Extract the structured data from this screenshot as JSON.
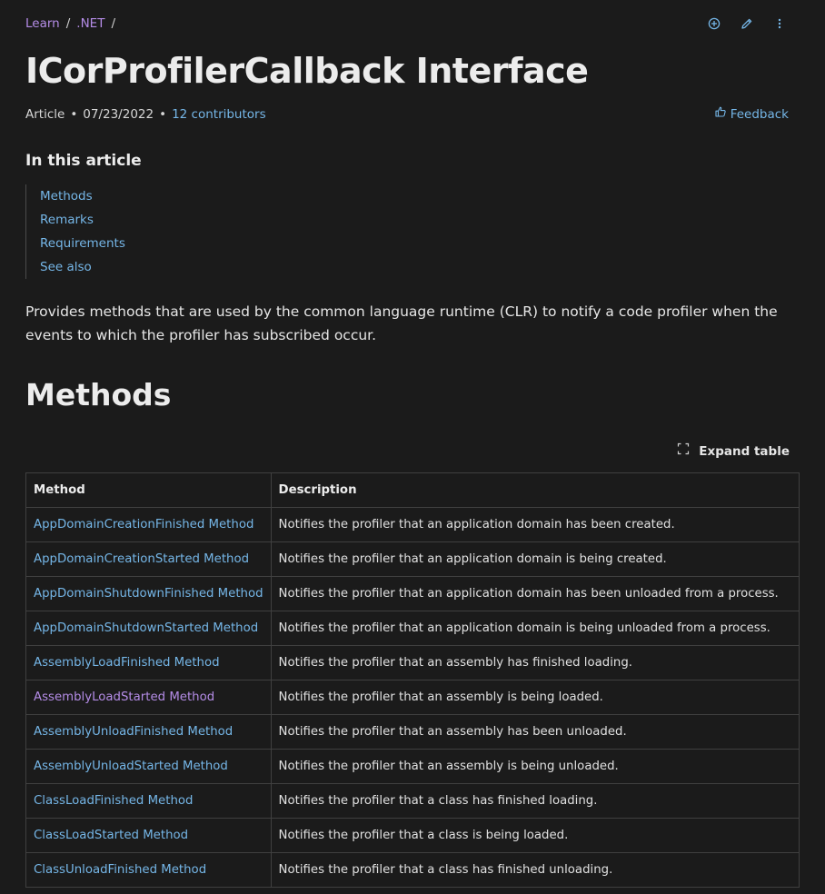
{
  "breadcrumb": {
    "items": [
      "Learn",
      ".NET"
    ],
    "separator": "/"
  },
  "top_actions": {
    "icons": [
      "add-circle-icon",
      "edit-pencil-icon",
      "more-vertical-icon"
    ]
  },
  "header": {
    "title": "ICorProfilerCallback Interface",
    "meta_type": "Article",
    "meta_date": "07/23/2022",
    "meta_contributors": "12 contributors",
    "feedback_label": "Feedback"
  },
  "toc": {
    "title": "In this article",
    "items": [
      "Methods",
      "Remarks",
      "Requirements",
      "See also"
    ]
  },
  "intro": "Provides methods that are used by the common language runtime (CLR) to notify a code profiler when the events to which the profiler has subscribed occur.",
  "methods_section": {
    "heading": "Methods",
    "expand_label": "Expand table",
    "columns": [
      "Method",
      "Description"
    ],
    "rows": [
      {
        "method": "AppDomainCreationFinished Method",
        "description": "Notifies the profiler that an application domain has been created."
      },
      {
        "method": "AppDomainCreationStarted Method",
        "description": "Notifies the profiler that an application domain is being created."
      },
      {
        "method": "AppDomainShutdownFinished Method",
        "description": "Notifies the profiler that an application domain has been unloaded from a process."
      },
      {
        "method": "AppDomainShutdownStarted Method",
        "description": "Notifies the profiler that an application domain is being unloaded from a process."
      },
      {
        "method": "AssemblyLoadFinished Method",
        "description": "Notifies the profiler that an assembly has finished loading."
      },
      {
        "method": "AssemblyLoadStarted Method",
        "description": "Notifies the profiler that an assembly is being loaded."
      },
      {
        "method": "AssemblyUnloadFinished Method",
        "description": "Notifies the profiler that an assembly has been unloaded."
      },
      {
        "method": "AssemblyUnloadStarted Method",
        "description": "Notifies the profiler that an assembly is being unloaded."
      },
      {
        "method": "ClassLoadFinished Method",
        "description": "Notifies the profiler that a class has finished loading."
      },
      {
        "method": "ClassLoadStarted Method",
        "description": "Notifies the profiler that a class is being loaded."
      },
      {
        "method": "ClassUnloadFinished Method",
        "description": "Notifies the profiler that a class has finished unloading."
      }
    ]
  },
  "colors": {
    "background": "#1b1b1b",
    "link": "#75b6e7",
    "visited_link": "#b48ce6",
    "text": "#e6e6e6",
    "border": "#404040"
  }
}
